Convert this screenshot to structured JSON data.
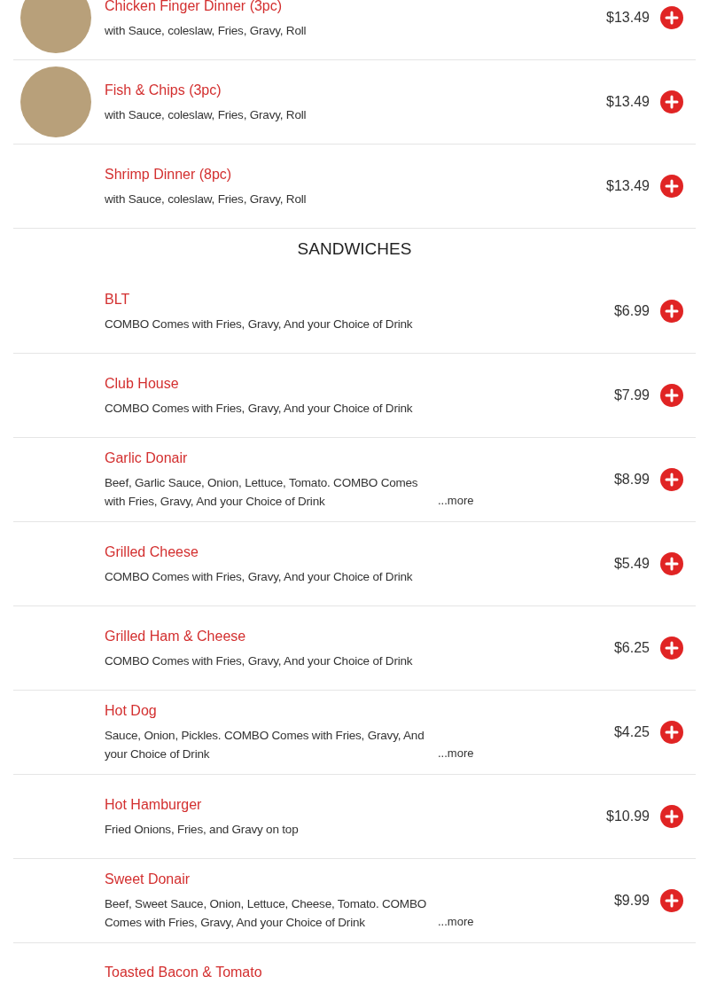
{
  "sections": [
    {
      "items": [
        {
          "name": "Chicken Finger Dinner (3pc)",
          "description": "with Sauce, coleslaw, Fries, Gravy, Roll",
          "price": "$13.49",
          "photo": true
        },
        {
          "name": "Fish & Chips (3pc)",
          "description": "with Sauce, coleslaw, Fries, Gravy, Roll",
          "price": "$13.49",
          "photo": true
        },
        {
          "name": "Shrimp Dinner (8pc)",
          "description": "with Sauce, coleslaw, Fries, Gravy, Roll",
          "price": "$13.49",
          "photo": false
        }
      ]
    },
    {
      "title": "SANDWICHES",
      "items": [
        {
          "name": "BLT",
          "description": "COMBO Comes with Fries, Gravy, And your Choice of Drink",
          "price": "$6.99",
          "photo": false
        },
        {
          "name": "Club House",
          "description": "COMBO Comes with Fries, Gravy, And your Choice of Drink",
          "price": "$7.99",
          "photo": false
        },
        {
          "name": "Garlic Donair",
          "description": "Beef, Garlic Sauce, Onion, Lettuce, Tomato. COMBO Comes with Fries, Gravy, And your Choice of Drink",
          "more": "...more",
          "price": "$8.99",
          "photo": false
        },
        {
          "name": "Grilled Cheese",
          "description": "COMBO Comes with Fries, Gravy, And your Choice of Drink",
          "price": "$5.49",
          "photo": false
        },
        {
          "name": "Grilled Ham & Cheese",
          "description": "COMBO Comes with Fries, Gravy, And your Choice of Drink",
          "price": "$6.25",
          "photo": false
        },
        {
          "name": "Hot Dog",
          "description": "Sauce, Onion, Pickles. COMBO Comes with Fries, Gravy, And your Choice of Drink",
          "more": "...more",
          "price": "$4.25",
          "photo": false
        },
        {
          "name": "Hot Hamburger",
          "description": "Fried Onions, Fries, and Gravy on top",
          "price": "$10.99",
          "photo": false
        },
        {
          "name": "Sweet Donair",
          "description": "Beef, Sweet Sauce, Onion, Lettuce, Cheese, Tomato. COMBO Comes with Fries, Gravy, And your Choice of Drink",
          "more": "...more",
          "price": "$9.99",
          "photo": false
        },
        {
          "name": "Toasted Bacon & Tomato",
          "photo": false
        }
      ]
    }
  ]
}
